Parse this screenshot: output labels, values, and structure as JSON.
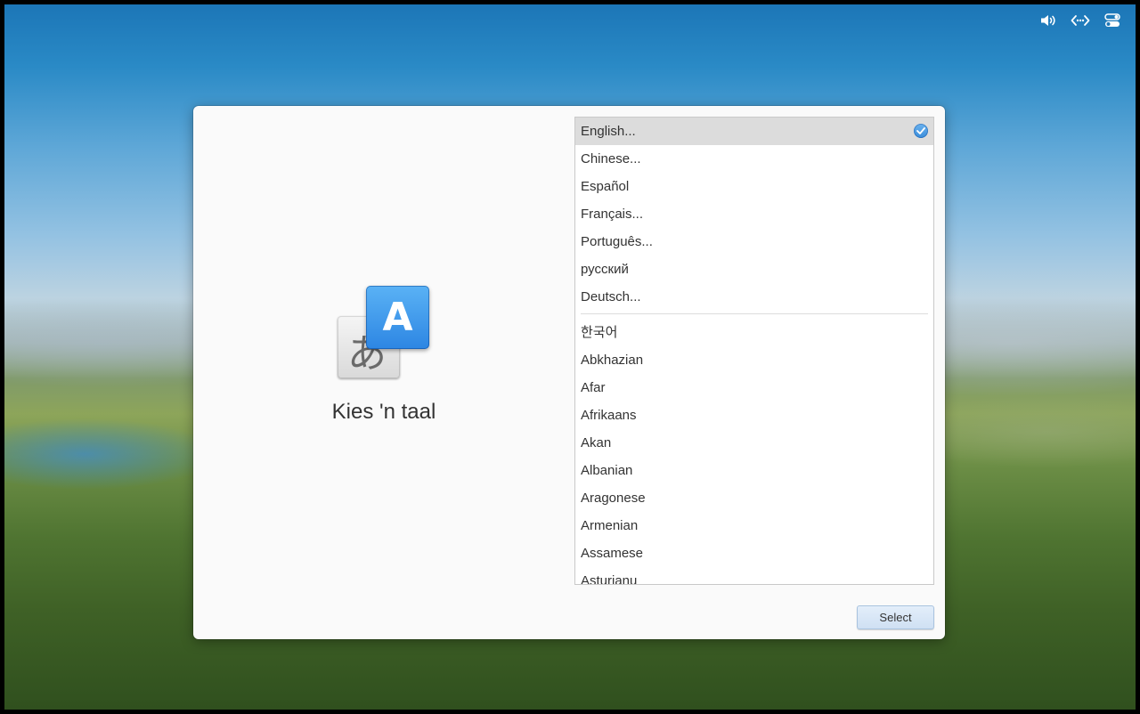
{
  "tray": {
    "icons": [
      "volume-icon",
      "network-icon",
      "toggle-settings-icon"
    ]
  },
  "dialog": {
    "title": "Kies 'n taal",
    "icon": {
      "back_glyph": "あ",
      "front_glyph": "A",
      "accent_color": "#2d86e3"
    },
    "featured_languages": [
      {
        "label": "English...",
        "selected": true
      },
      {
        "label": "Chinese...",
        "selected": false
      },
      {
        "label": "Español",
        "selected": false
      },
      {
        "label": "Français...",
        "selected": false
      },
      {
        "label": "Português...",
        "selected": false
      },
      {
        "label": "русский",
        "selected": false
      },
      {
        "label": "Deutsch...",
        "selected": false
      }
    ],
    "other_languages": [
      "한국어",
      "Abkhazian",
      "Afar",
      "Afrikaans",
      "Akan",
      "Albanian",
      "Aragonese",
      "Armenian",
      "Assamese",
      "Asturianu"
    ],
    "select_label": "Select"
  }
}
